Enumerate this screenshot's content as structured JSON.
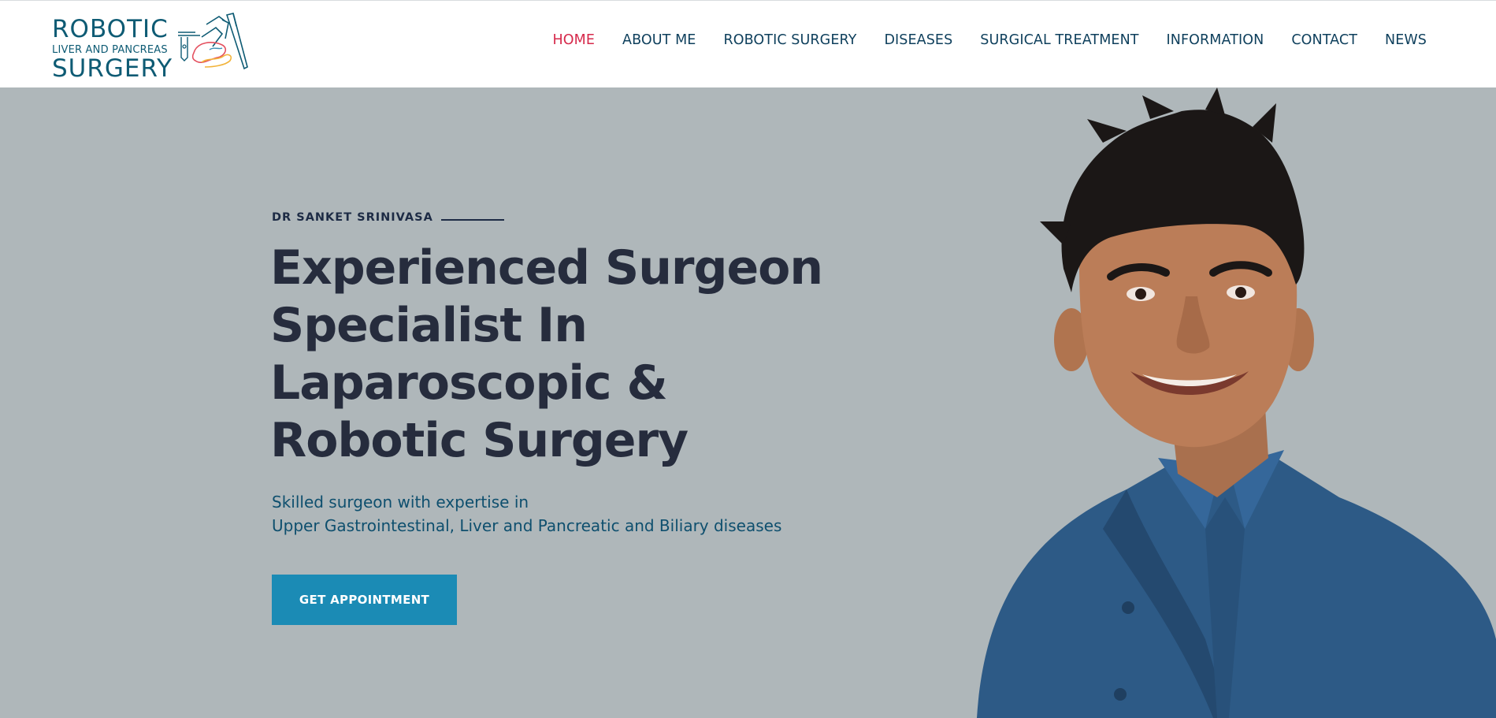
{
  "brand": {
    "line1": "ROBOTIC",
    "line2": "LIVER AND PANCREAS",
    "line3": "SURGERY",
    "primary_color": "#0e5b74",
    "accent_colors": [
      "#e4505f",
      "#f2b33a",
      "#3c8fb5"
    ]
  },
  "nav": {
    "items": [
      {
        "label": "HOME",
        "active": true
      },
      {
        "label": "ABOUT ME",
        "active": false
      },
      {
        "label": "ROBOTIC SURGERY",
        "active": false
      },
      {
        "label": "DISEASES",
        "active": false
      },
      {
        "label": "SURGICAL TREATMENT",
        "active": false
      },
      {
        "label": "INFORMATION",
        "active": false
      },
      {
        "label": "CONTACT",
        "active": false
      },
      {
        "label": "NEWS",
        "active": false
      }
    ],
    "active_color": "#d6294b",
    "text_color": "#0e3f5c"
  },
  "hero": {
    "eyebrow": "DR SANKET SRINIVASA",
    "headline": "Experienced Surgeon Specialist In Laparoscopic & Robotic Surgery",
    "subtitle_line1": "Skilled surgeon with expertise in",
    "subtitle_line2": "Upper Gastrointestinal, Liver and Pancreatic and Biliary diseases",
    "cta_label": "GET APPOINTMENT",
    "background_color": "#afb7ba",
    "cta_color": "#1b8bb5",
    "portrait_icon": "doctor-portrait"
  }
}
